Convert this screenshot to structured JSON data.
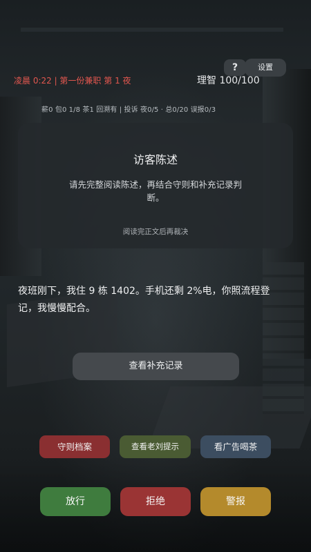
{
  "top_bar": {
    "help_label": "?",
    "settings_label": "设置",
    "night_status": "凌晨 0:22 | 第一份兼职 第 1 夜",
    "sanity": "理智 100/100",
    "stats": "薪0 包0 1/8 茶1 回溯有 | 投诉 夜0/5 · 总0/20 误报0/3"
  },
  "visitor_card": {
    "title": "访客陈述",
    "body": "请先完整阅读陈述，再结合守则和补充记录判断。",
    "hint": "阅读完正文后再裁决"
  },
  "dialogue": {
    "text": "夜班刚下，我住 9 栋 1402。手机还剩 2%电，你照流程登记，我慢慢配合。"
  },
  "actions": {
    "supplementary_label": "查看补充记录",
    "rules_label": "守则档案",
    "hint_label": "查看老刘提示",
    "tea_label": "看广告喝茶"
  },
  "verdict": {
    "pass_label": "放行",
    "refuse_label": "拒绝",
    "alarm_label": "警报"
  },
  "colors": {
    "night_status": "#e2574f",
    "rules_button": "#8a2f31",
    "hint_button": "#4a5b33",
    "tea_button": "#3c4d60",
    "pass_button": "#3f7c3e",
    "refuse_button": "#9a3434",
    "alarm_button": "#b48a2c"
  }
}
